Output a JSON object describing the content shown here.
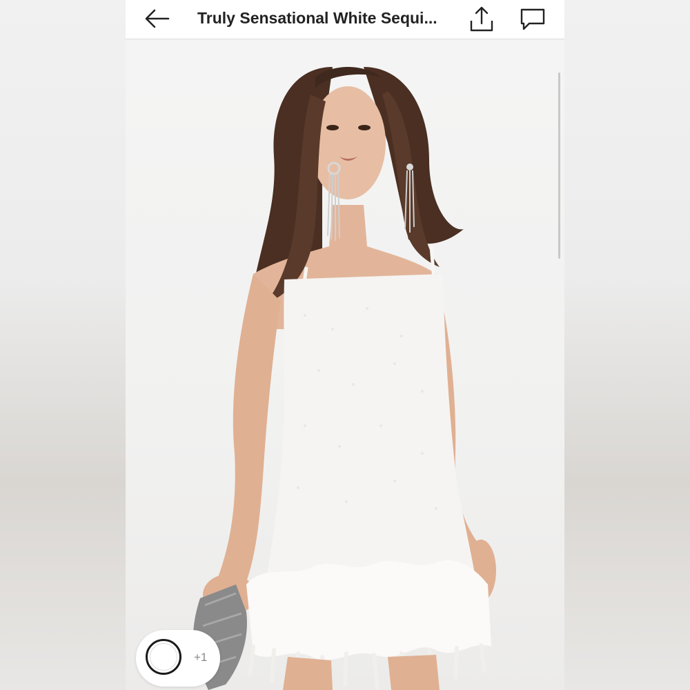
{
  "header": {
    "title": "Truly Sensational White Sequi...",
    "back_icon": "arrow-left-icon",
    "share_icon": "share-upload-icon",
    "comment_icon": "comment-bubble-icon"
  },
  "product": {
    "image_alt": "Model wearing white sequin mini dress with feather hem, holding a silver clutch",
    "dress_color": "#f5f4f2",
    "feather_color": "#fbfaf8",
    "hair_color": "#4a2f22",
    "skin_color": "#e2b59a"
  },
  "variants": {
    "selected_color": "#ffffff",
    "more_label": "+1"
  }
}
